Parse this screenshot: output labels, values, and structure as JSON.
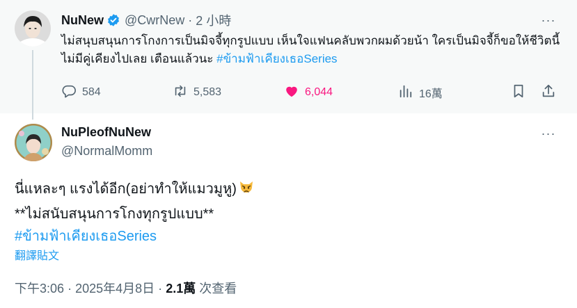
{
  "parent": {
    "name": "NuNew",
    "handle": "@CwrNew",
    "time": "2 小時",
    "text_main": "ไม่สนุบสนุนการโกงการเป็นมิจจี้ทุกรูปแบบ เห็นใจแฟนคลับพวกผมด้วยน้า ใครเป็นมิจจี้ก็ขอให้ชีวิตนี้ไม่มีคู่เคียงไปเลย เตือนแล้วนะ ",
    "hashtag": "#ข้ามฟ้าเคียงเธอSeries",
    "replies": "584",
    "retweets": "5,583",
    "likes": "6,044",
    "views": "16萬",
    "more": "···"
  },
  "reply": {
    "name": "NuPleofNuNew",
    "handle": "@NormalMomm",
    "line1": "นี่แหละๆ แรงได้อีก(อย่าทำให้แมวมูหู)",
    "line2": "**ไม่สนับสนุนการโกงทุกรูปแบบ**",
    "hashtag": "#ข้ามฟ้าเคียงเธอSeries",
    "translate": "翻譯貼文",
    "time": "下午3:06",
    "date": "2025年4月8日",
    "views_count": "2.1萬",
    "views_label": "次查看",
    "more": "···",
    "sep": "·"
  },
  "colors": {
    "accent": "#1d9bf0",
    "like": "#f91880",
    "muted": "#536471"
  },
  "icons": [
    "verified-badge-icon",
    "reply-icon",
    "retweet-icon",
    "heart-icon",
    "views-icon",
    "bookmark-icon",
    "share-icon",
    "more-icon",
    "pouting-cat-emoji"
  ]
}
